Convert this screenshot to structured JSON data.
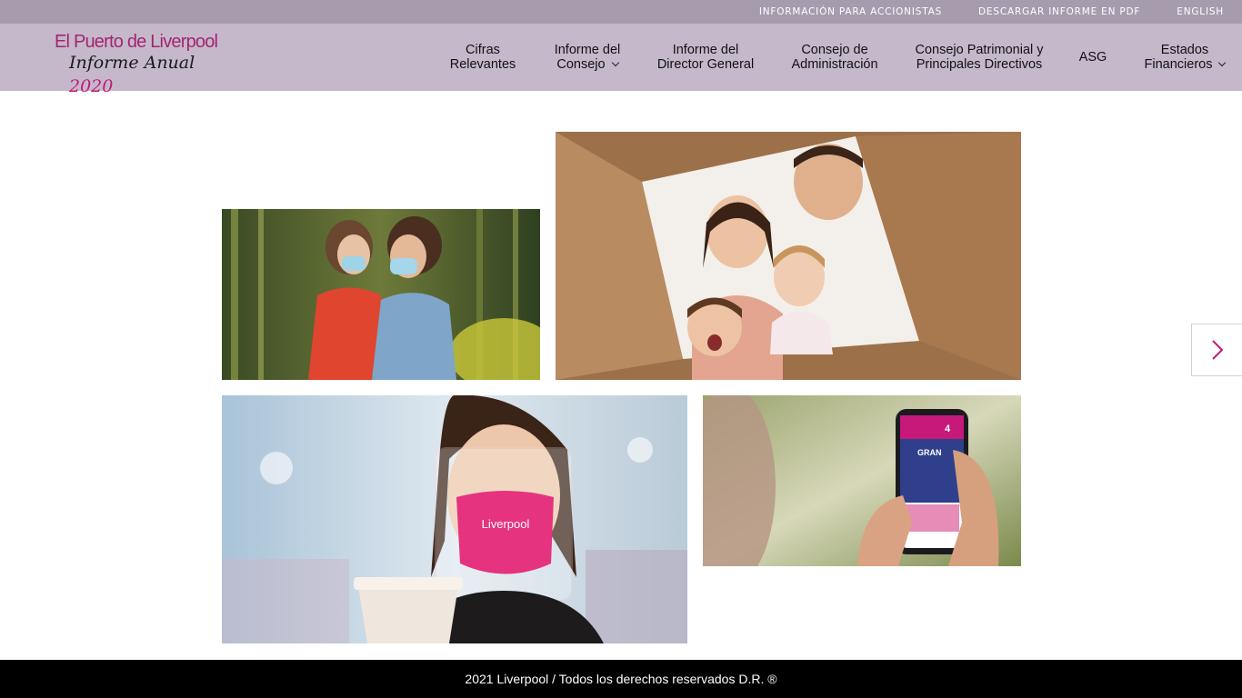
{
  "topbar": {
    "links": [
      "INFORMACIÓN PARA ACCIONISTAS",
      "DESCARGAR INFORME EN PDF",
      "ENGLISH"
    ]
  },
  "logo": {
    "line1": "El Puerto de Liverpool",
    "line2a": "Informe Anual",
    "line2b": "2020"
  },
  "nav": {
    "cifras": [
      "Cifras",
      "Relevantes"
    ],
    "informe_consejo": [
      "Informe del",
      "Consejo"
    ],
    "informe_director": [
      "Informe del",
      "Director General"
    ],
    "consejo_admin": [
      "Consejo de",
      "Administración"
    ],
    "consejo_patrimonial": [
      "Consejo Patrimonial y",
      "Principales Directivos"
    ],
    "asg": "ASG",
    "estados": [
      "Estados",
      "Financieros"
    ]
  },
  "photos": {
    "mask_brand": "Liverpool",
    "phone_text1": "GRAN",
    "phone_text2": "4"
  },
  "colors": {
    "topbar": "#a79cae",
    "navbar": "#c5b8cb",
    "accent": "#c21b78",
    "footer": "#000000"
  },
  "footer": {
    "text": "2021 Liverpool / Todos los derechos reservados D.R. ®"
  }
}
